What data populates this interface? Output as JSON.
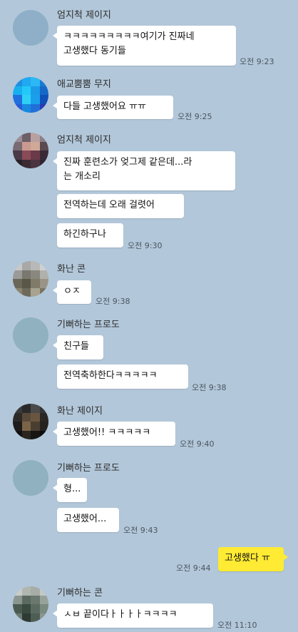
{
  "messages": [
    {
      "sender": "엄지척 제이지",
      "lines": [
        "ㅋㅋㅋㅋㅋㅋㅋㅋㅋ여기가 진짜네",
        "고생했다 동기들"
      ],
      "time": "오전 9:23"
    },
    {
      "sender": "애교뿜뿜 무지",
      "lines": [
        "다들 고생했어요 ㅠㅠ"
      ],
      "time": "오전 9:25"
    },
    {
      "sender": "엄지척 제이지",
      "lines": [
        "진짜 훈련소가 엊그제 같은데...라",
        "는 개소리"
      ]
    },
    {
      "lines": [
        "전역하는데 오래 걸렷어"
      ]
    },
    {
      "lines": [
        "하긴하구나"
      ],
      "time": "오전 9:30"
    },
    {
      "sender": "화난 콘",
      "lines": [
        "ㅇㅈ"
      ],
      "time": "오전 9:38"
    },
    {
      "sender": "기뻐하는 프로도",
      "lines": [
        "친구들"
      ]
    },
    {
      "lines": [
        "전역축하한다ㅋㅋㅋㅋㅋ"
      ],
      "time": "오전 9:38"
    },
    {
      "sender": "화난 제이지",
      "lines": [
        "고생했어!! ㅋㅋㅋㅋㅋ"
      ],
      "time": "오전 9:40"
    },
    {
      "sender": "기뻐하는 프로도",
      "lines": [
        "형..."
      ]
    },
    {
      "lines": [
        "고생했어..."
      ],
      "time": "오전 9:43"
    },
    {
      "sender": "me",
      "lines": [
        "고생했다 ㅠ"
      ],
      "time": "오전 9:44"
    },
    {
      "sender": "기뻐하는 콘",
      "lines": [
        "ㅅㅂ 끝이다ㅏㅏㅏㅏㅋㅋㅋㅋ"
      ],
      "time": "오전 11:10"
    }
  ],
  "colors": {
    "background": "#b2c7d9",
    "incoming_bubble": "#ffffff",
    "outgoing_bubble": "#ffeb33"
  }
}
